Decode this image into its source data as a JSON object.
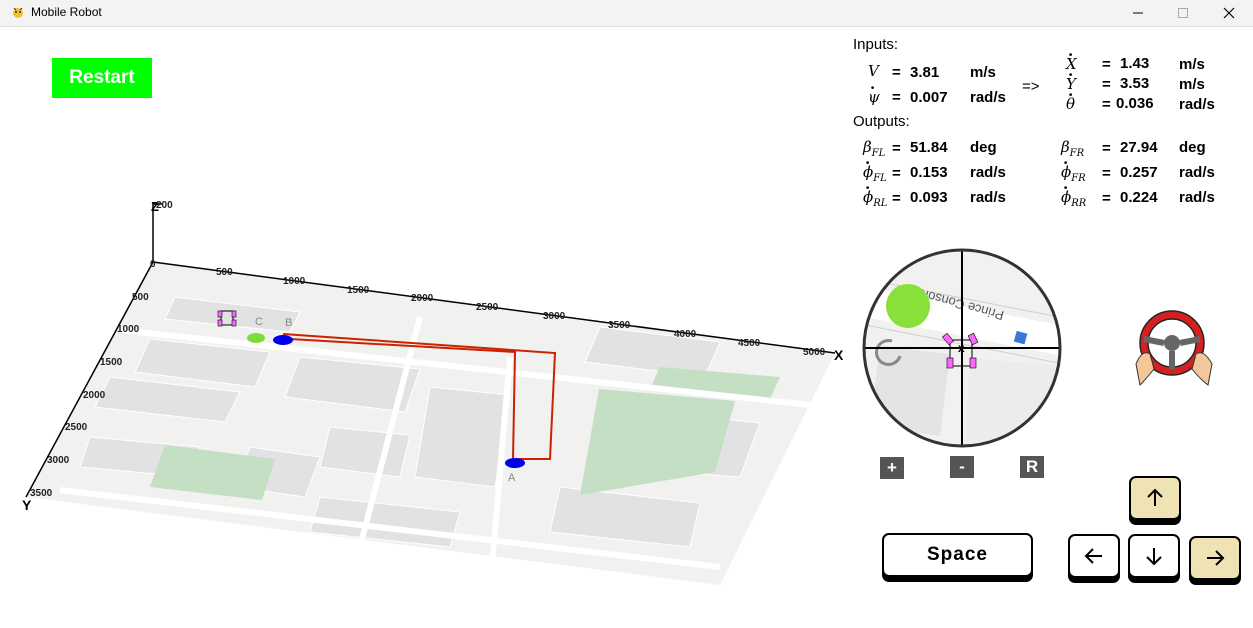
{
  "window": {
    "title": "Mobile Robot"
  },
  "restart_label": "Restart",
  "plot": {
    "x_axis_label": "X",
    "y_axis_label": "Y",
    "z_axis_label": "Z",
    "z_top_tick": "200",
    "origin_tick": "0",
    "x_ticks": [
      "500",
      "1000",
      "1500",
      "2000",
      "2500",
      "3000",
      "3500",
      "4000",
      "4500",
      "5000"
    ],
    "y_ticks": [
      "500",
      "1000",
      "1500",
      "2000",
      "2500",
      "3000",
      "3500"
    ],
    "waypoints": {
      "a": "A",
      "b": "B",
      "c": "C"
    }
  },
  "inputs": {
    "header": "Inputs:",
    "v": {
      "value": "3.81",
      "unit": "m/s"
    },
    "psi_dot": {
      "value": "0.007",
      "unit": "rad/s"
    },
    "arrow": "=>",
    "x_dot": {
      "value": "1.43",
      "unit": "m/s"
    },
    "y_dot": {
      "value": "3.53",
      "unit": "m/s"
    },
    "theta_dot": {
      "value": "0.036",
      "unit": "rad/s"
    }
  },
  "outputs": {
    "header": "Outputs:",
    "beta_fl": {
      "value": "51.84",
      "unit": "deg"
    },
    "beta_fr": {
      "value": "27.94",
      "unit": "deg"
    },
    "phi_fl": {
      "value": "0.153",
      "unit": "rad/s"
    },
    "phi_fr": {
      "value": "0.257",
      "unit": "rad/s"
    },
    "phi_rl": {
      "value": "0.093",
      "unit": "rad/s"
    },
    "phi_rr": {
      "value": "0.224",
      "unit": "rad/s"
    }
  },
  "minimap": {
    "street_label": "Prince Consort"
  },
  "zoom_buttons": {
    "zoom_in": "+",
    "zoom_out": "-",
    "reset": "R"
  },
  "keys": {
    "space": "Space",
    "up": "↑",
    "down": "↓",
    "left": "←",
    "right": "→"
  },
  "colors": {
    "restart": "#00ff00",
    "path": "#cc2200",
    "waypoint_blue": "#0000ee",
    "waypoint_green": "#7cdc3c",
    "key_active": "#efe2b4"
  }
}
